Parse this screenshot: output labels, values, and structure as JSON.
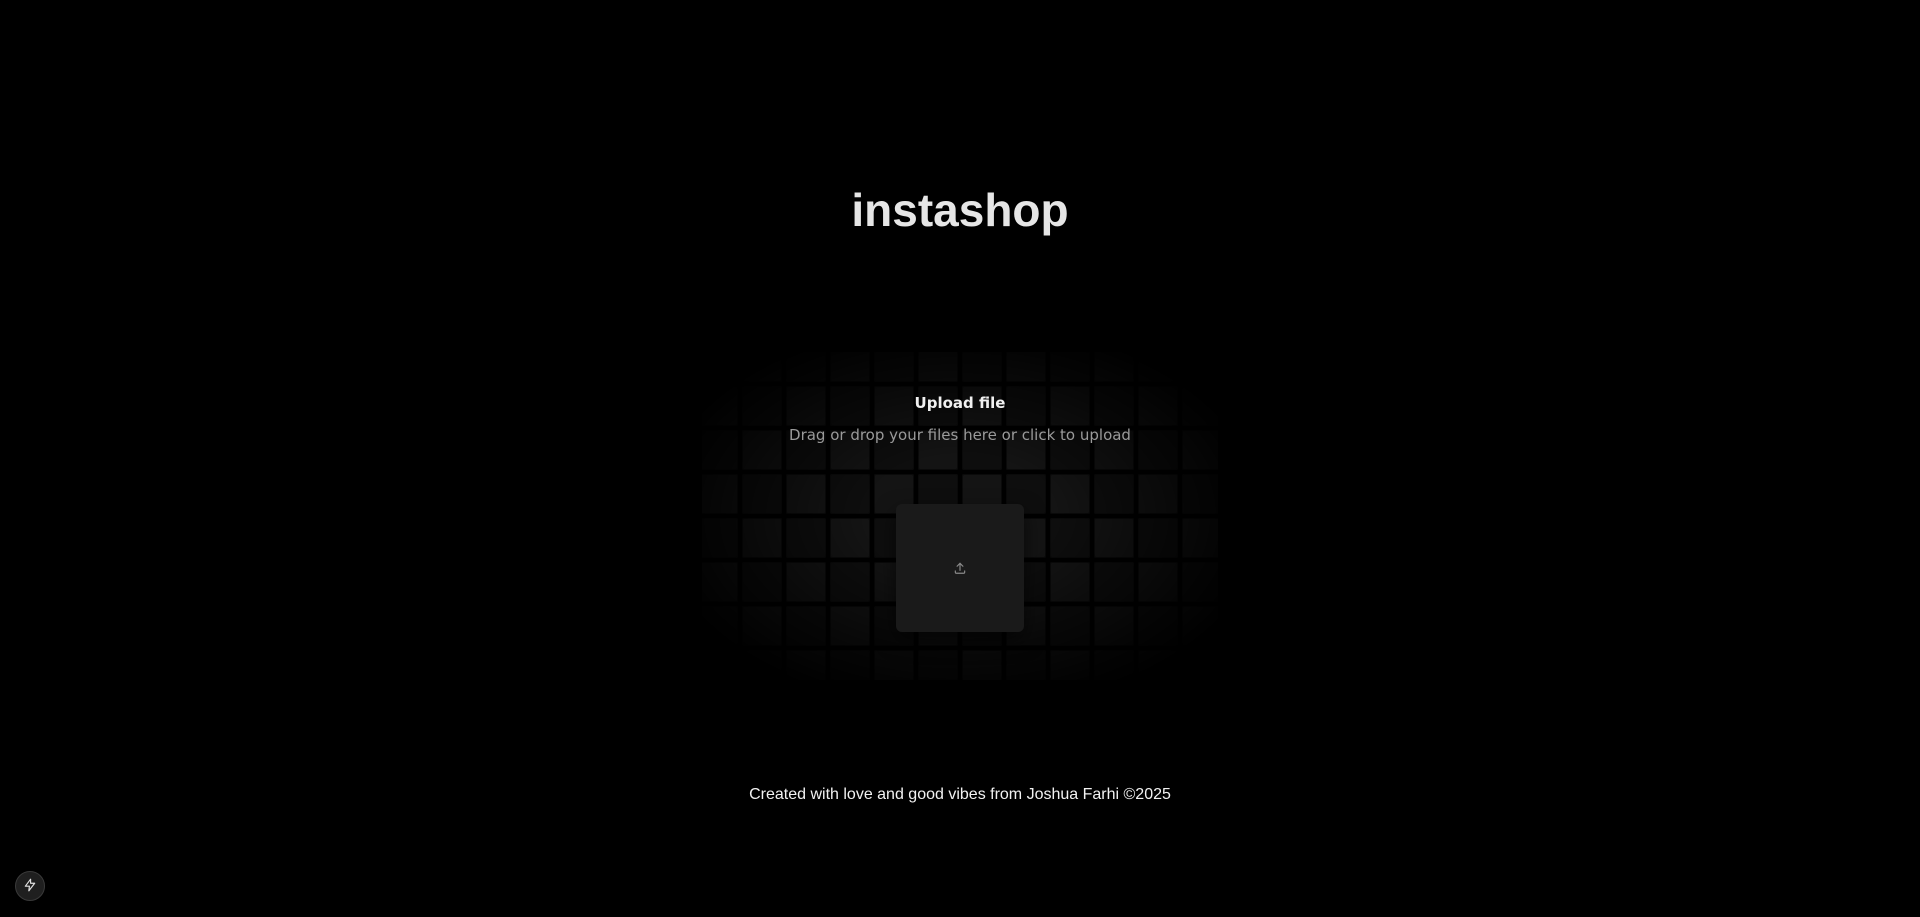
{
  "app": {
    "title": "instashop"
  },
  "upload": {
    "label": "Upload file",
    "hint": "Drag or drop your files here or click to upload",
    "icon": "upload-icon"
  },
  "footer": {
    "text": "Created with love and good vibes from Joshua Farhi ©2025"
  },
  "dev_badge": {
    "icon": "lightning-bolt-icon"
  },
  "colors": {
    "background": "#000000",
    "title": "#e6e6e6",
    "hint": "#9a9a9a",
    "upload_box": "#1a1a1a"
  }
}
